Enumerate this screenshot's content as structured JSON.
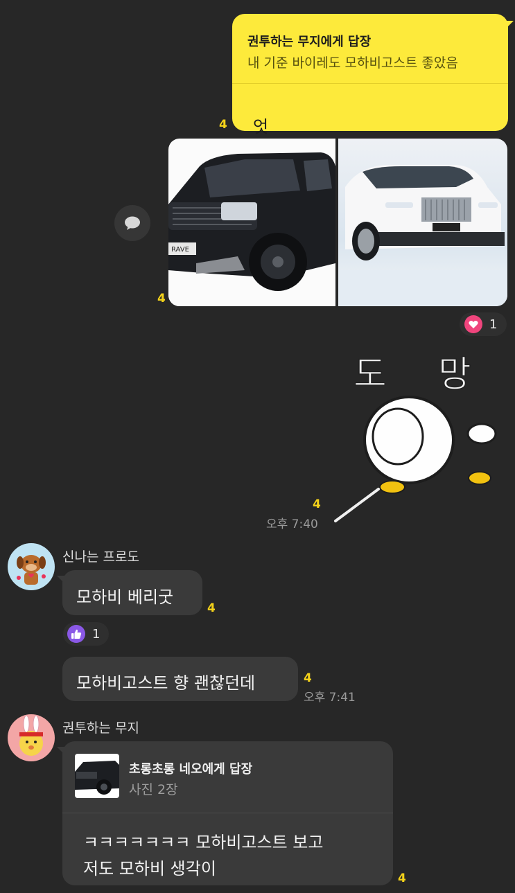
{
  "my_reply": {
    "quote_title": "권투하는 무지에게 답장",
    "quote_text": "내 기준 바이레도 모하비고스트 좋았음",
    "message": "엇",
    "unread": "4"
  },
  "photos": {
    "unread": "4",
    "reaction_count": "1"
  },
  "sticker": {
    "text1": "도",
    "text2": "망",
    "unread": "4",
    "time": "오후 7:40"
  },
  "frodo": {
    "name": "신나는 프로도",
    "msg1": "모하비 베리굿",
    "msg1_unread": "4",
    "msg1_reaction_count": "1",
    "msg2": "모하비고스트 향 괜찮던데",
    "msg2_unread": "4",
    "msg2_time": "오후 7:41"
  },
  "muzi": {
    "name": "권투하는 무지",
    "reply_title": "초롱초롱 네오에게 답장",
    "reply_sub": "사진 2장",
    "line1": "ㅋㅋㅋㅋㅋㅋㅋ 모하비고스트 보고",
    "line2": "저도 모하비 생각이",
    "unread": "4"
  }
}
